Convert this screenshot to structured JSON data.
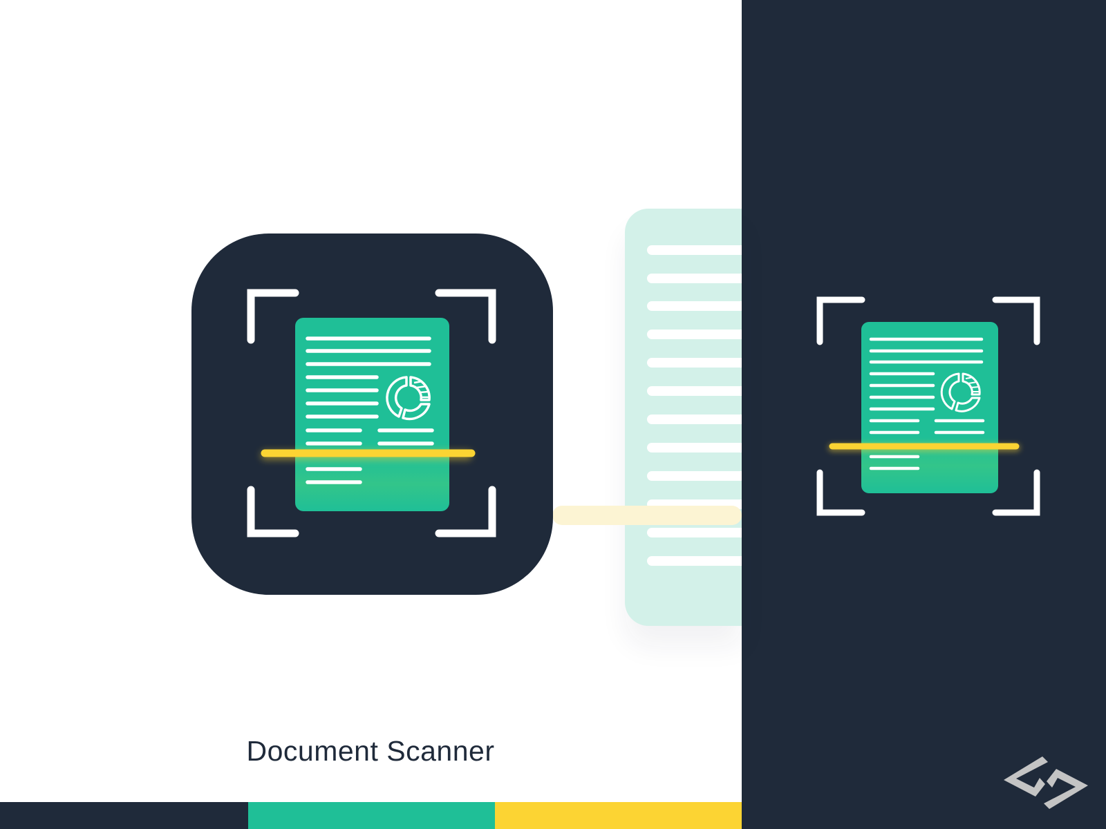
{
  "title": "Document Scanner",
  "icons": {
    "app": "document-scanner-app-icon",
    "preview": "document-scanner-icon",
    "logo": "brand-logo-icon"
  },
  "colors": {
    "navy": "#1f2a3a",
    "green": "#1fbf97",
    "mint": "#d3f1e9",
    "yellow": "#fcd433",
    "white": "#ffffff",
    "logo_gray": "#c4c4c4"
  },
  "color_bars": [
    "#1f2a3a",
    "#1fbf97",
    "#fcd433"
  ]
}
